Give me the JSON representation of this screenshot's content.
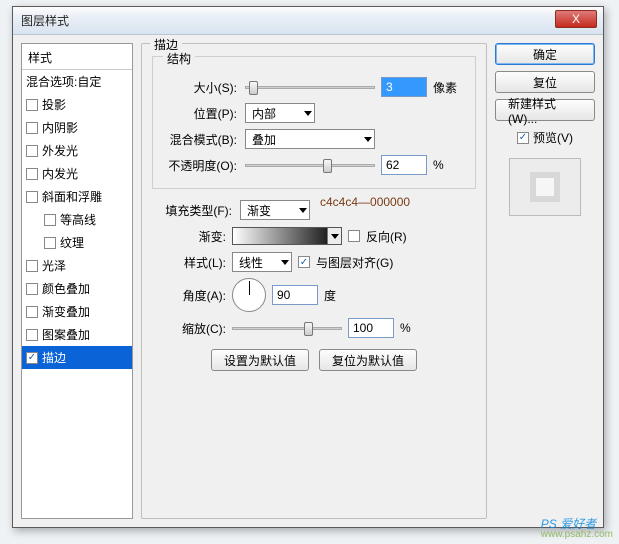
{
  "window": {
    "title": "图层样式",
    "close": "X"
  },
  "styles": {
    "header": "样式",
    "blend_options": "混合选项:自定",
    "items": [
      {
        "label": "投影",
        "indent": false,
        "checked": false
      },
      {
        "label": "内阴影",
        "indent": false,
        "checked": false
      },
      {
        "label": "外发光",
        "indent": false,
        "checked": false
      },
      {
        "label": "内发光",
        "indent": false,
        "checked": false
      },
      {
        "label": "斜面和浮雕",
        "indent": false,
        "checked": false
      },
      {
        "label": "等高线",
        "indent": true,
        "checked": false
      },
      {
        "label": "纹理",
        "indent": true,
        "checked": false
      },
      {
        "label": "光泽",
        "indent": false,
        "checked": false
      },
      {
        "label": "颜色叠加",
        "indent": false,
        "checked": false
      },
      {
        "label": "渐变叠加",
        "indent": false,
        "checked": false
      },
      {
        "label": "图案叠加",
        "indent": false,
        "checked": false
      },
      {
        "label": "描边",
        "indent": false,
        "checked": true,
        "selected": true
      }
    ]
  },
  "stroke": {
    "panel_title": "描边",
    "structure_title": "结构",
    "size_label": "大小(S):",
    "size_value": "3",
    "size_unit": "像素",
    "position_label": "位置(P):",
    "position_value": "内部",
    "blendmode_label": "混合模式(B):",
    "blendmode_value": "叠加",
    "opacity_label": "不透明度(O):",
    "opacity_value": "62",
    "opacity_unit": "%",
    "filltype_label": "填充类型(F):",
    "filltype_value": "渐变",
    "gradient_label": "渐变:",
    "reverse_label": "反向(R)",
    "style_label": "样式(L):",
    "style_value": "线性",
    "align_label": "与图层对齐(G)",
    "angle_label": "角度(A):",
    "angle_value": "90",
    "angle_unit": "度",
    "scale_label": "缩放(C):",
    "scale_value": "100",
    "scale_unit": "%",
    "set_default": "设置为默认值",
    "reset_default": "复位为默认值",
    "annotation": "c4c4c4—000000"
  },
  "buttons": {
    "ok": "确定",
    "cancel": "复位",
    "new_style": "新建样式(W)...",
    "preview": "预览(V)"
  },
  "watermark": {
    "main": "PS 爱好者",
    "sub": "www.psahz.com"
  }
}
